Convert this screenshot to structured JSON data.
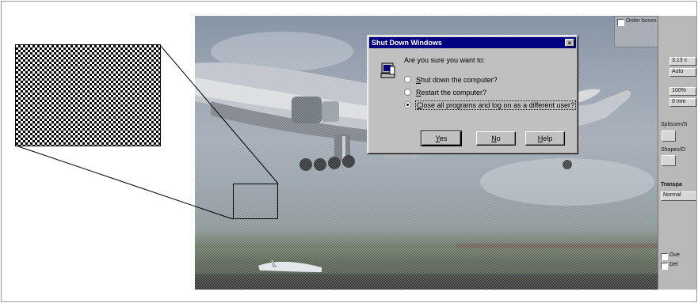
{
  "dialog": {
    "title": "Shut Down Windows",
    "close_glyph": "×",
    "question": "Are you sure you want to:",
    "options": [
      {
        "pre": "",
        "key": "S",
        "rest": "hut down the computer?",
        "selected": false
      },
      {
        "pre": "",
        "key": "R",
        "rest": "estart the computer?",
        "selected": false
      },
      {
        "pre": "",
        "key": "C",
        "rest": "lose all programs and log on as a different user?",
        "selected": true
      }
    ],
    "buttons": [
      {
        "key": "Y",
        "rest": "es"
      },
      {
        "key": "N",
        "rest": "o"
      },
      {
        "key": "H",
        "rest": "elp"
      }
    ]
  },
  "palette": {
    "top_label": "Order boxes",
    "fields": [
      "3.13 c",
      "Auto",
      "100%",
      "0 mm"
    ],
    "section_labels": [
      "Spitssen/S",
      "Shapes/O",
      "Transpa"
    ],
    "dropdown": "Normal",
    "checks": [
      "Ove",
      "Del"
    ]
  },
  "icons": {
    "dialog_icon": "computer-shutdown-icon"
  },
  "colors": {
    "titlebar": "#000080",
    "dialog_face": "#c0c0c0"
  }
}
